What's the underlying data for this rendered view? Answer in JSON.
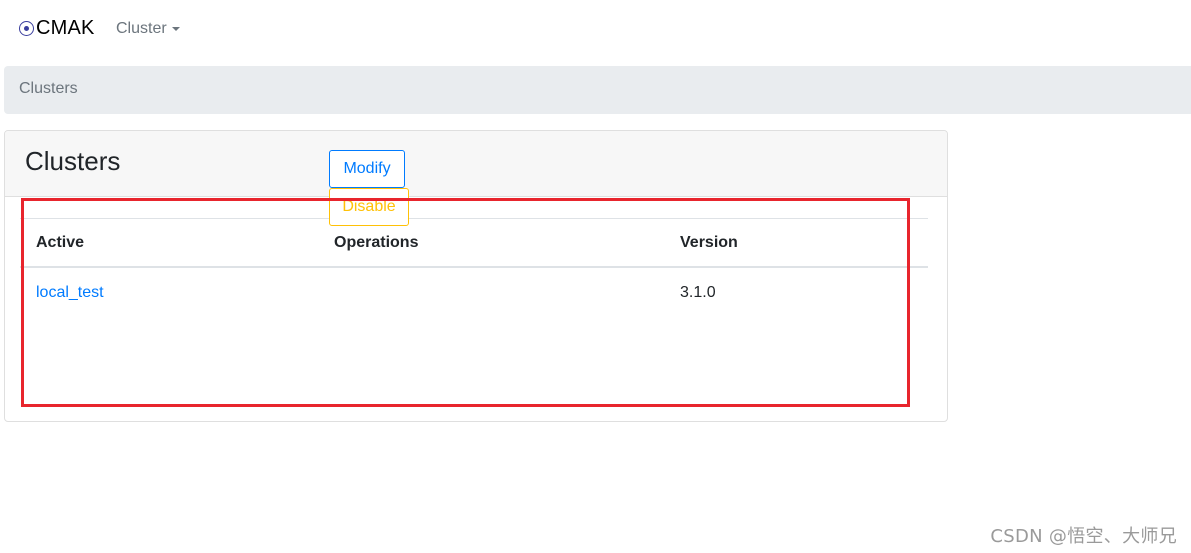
{
  "navbar": {
    "brand": "CMAK",
    "brand_icon": "target-circle-icon",
    "dropdown_label": "Cluster"
  },
  "breadcrumb": {
    "items": [
      "Clusters"
    ]
  },
  "card": {
    "title": "Clusters",
    "table": {
      "headers": [
        "Active",
        "Operations",
        "Version"
      ],
      "rows": [
        {
          "active": "local_test",
          "operations": [
            "Modify",
            "Disable"
          ],
          "version": "3.1.0"
        }
      ]
    }
  },
  "annotation": {
    "highlight_color": "#e8252d"
  },
  "watermark": "CSDN @悟空、大师兄",
  "colors": {
    "link": "#007bff",
    "warning": "#ffc107",
    "breadcrumb_bg": "#e9ecef"
  }
}
